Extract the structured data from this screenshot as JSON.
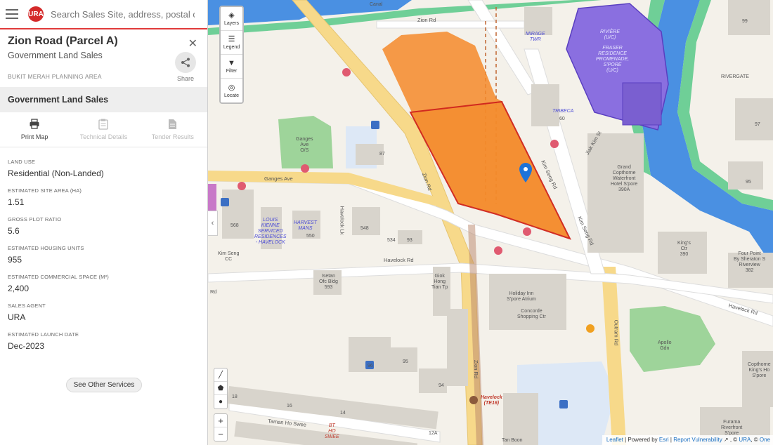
{
  "search": {
    "placeholder": "Search Sales Site, address, postal code"
  },
  "logo": {
    "text": "URA"
  },
  "site": {
    "title": "Zion Road (Parcel A)",
    "subtitle": "Government Land Sales",
    "planning_area": "BUKIT MERAH PLANNING AREA",
    "share_label": "Share"
  },
  "section": {
    "title": "Government Land Sales"
  },
  "tools": [
    {
      "label": "Print Map",
      "icon": "printer-icon",
      "enabled": true
    },
    {
      "label": "Technical Details",
      "icon": "clipboard-icon",
      "enabled": false
    },
    {
      "label": "Tender Results",
      "icon": "document-icon",
      "enabled": false
    }
  ],
  "fields": [
    {
      "label": "LAND USE",
      "value": "Residential (Non-Landed)"
    },
    {
      "label": "ESTIMATED SITE AREA (HA)",
      "value": "1.51"
    },
    {
      "label": "GROSS PLOT RATIO",
      "value": "5.6"
    },
    {
      "label": "ESTIMATED HOUSING UNITS",
      "value": "955"
    },
    {
      "label": "ESTIMATED COMMERCIAL SPACE (M²)",
      "value": "2,400"
    },
    {
      "label": "SALES AGENT",
      "value": "URA"
    },
    {
      "label": "ESTIMATED LAUNCH DATE",
      "value": "Dec-2023"
    }
  ],
  "other_services_label": "See Other Services",
  "map_controls": [
    {
      "label": "Layers",
      "icon": "layers-icon"
    },
    {
      "label": "Legend",
      "icon": "legend-icon"
    },
    {
      "label": "Filter",
      "icon": "filter-icon"
    },
    {
      "label": "Locate",
      "icon": "locate-icon"
    }
  ],
  "zoom": {
    "in": "+",
    "out": "−"
  },
  "map_labels": {
    "canal": "Canal",
    "zion_rd_top": "Zion Rd",
    "mirage": "MIRAGE\nTWR",
    "riviere": "RIVIÈRE\n(U/C)",
    "fraser": "FRASER\nRESIDENCE\nPROMENADE,\nS'PORE\n(U/C)",
    "rivergate": "RIVERGATE",
    "n99": "99",
    "n97": "97",
    "n95": "95",
    "tribeca": "TRIBECA",
    "n60": "60",
    "jiak_kim": "Jiak Kim St",
    "ganges_gdn": "Ganges\nAve\nO/S",
    "ganges_ave": "Ganges Ave",
    "n87": "87",
    "zion_rd_mid": "Zion Rd",
    "kim_seng_rd_1": "Kim Seng Rd",
    "kim_seng_rd_2": "Kim Seng Rd",
    "grand_copthorne": "Grand\nCopthorne\nWaterfront\nHotel S'pore\n390A",
    "louis_kienne": "LOUIS\nKIENNE\nSERVICED\nRESIDENCES\n- HAVELOCK",
    "harvest": "HARVEST\nMANS",
    "n568": "568",
    "n550": "550",
    "n548": "548",
    "n534": "534",
    "n93": "93",
    "havelock_lk": "Havelock Lk",
    "kim_seng_cc": "Kim Seng\nCC",
    "kings_ctr": "King's\nCtr\n390",
    "four_points": "Four Point\nBy Sheraton S\nRiverview\n382",
    "havelock_rd_1": "Havelock Rd",
    "havelock_rd_2": "Havelock Rd",
    "isetan": "Isetan\nOfc Bldg\n593",
    "giok_hong": "Giok\nHong\nTian Tp",
    "holiday_inn": "Holiday Inn\nS'pore Atrium",
    "concorde": "Concorde\nShopping Ctr",
    "outram_rd": "Outram Rd",
    "apollo": "Apollo\nGdn",
    "n96": "96",
    "n95b": "95",
    "n94": "94",
    "zion_rd_low": "Zion Rd",
    "havelock_station": "Havelock\n(TE16)",
    "copthorne_kings": "Copthorne\nKing's Ho\nS'pore",
    "furama": "Furama\nRiverfront\nS'pore",
    "n18": "18",
    "n16": "16",
    "n14": "14",
    "n12a": "12A",
    "taman_ho_swee": "Taman Ho Swee",
    "bt_ho_swee": "BT\nHO\nSWEE",
    "tan_boon": "Tan Boon",
    "rd_left": "Rd"
  },
  "attribution": {
    "leaflet": "Leaflet",
    "powered": " | Powered by ",
    "esri": "Esri",
    "sep": " | ",
    "report": "Report Vulnerability",
    "ura": "URA",
    "onemap": "One"
  },
  "colors": {
    "accent": "#e03a3a",
    "parcel_fill": "#f58a2a",
    "parcel_outline": "#d0231a",
    "river": "#4a90e2",
    "park": "#9ed49a",
    "purple_dev": "#8a6fe0"
  }
}
